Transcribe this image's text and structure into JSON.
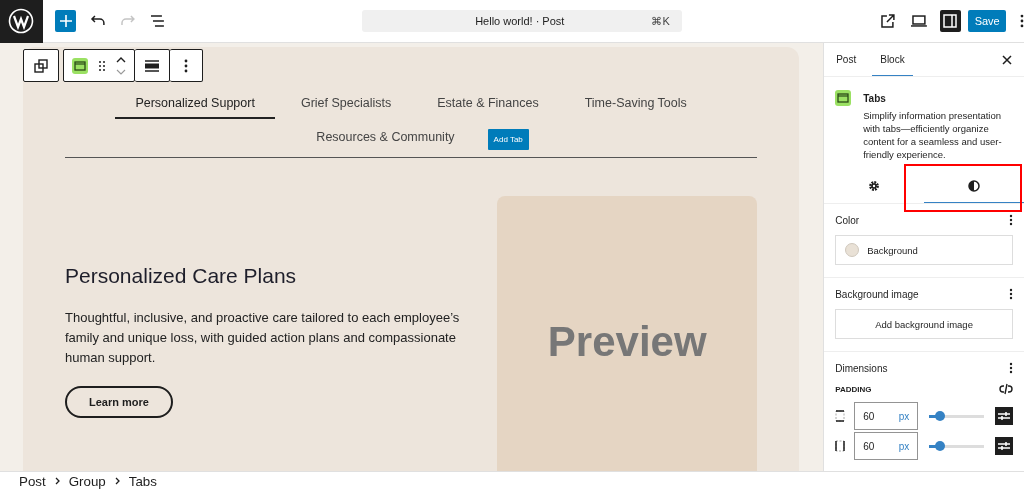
{
  "top_bar": {
    "command_title": "Hello world! · Post",
    "shortcut": "⌘K",
    "redo_disabled": true,
    "sidebar_on": true,
    "save": "Save"
  },
  "tabs_block": {
    "tabs": [
      {
        "label": "Personalized Support",
        "selected": true
      },
      {
        "label": "Grief Specialists",
        "selected": false
      },
      {
        "label": "Estate & Finances",
        "selected": false
      },
      {
        "label": "Time-Saving Tools",
        "selected": false
      },
      {
        "label": "Resources & Community",
        "selected": false
      }
    ],
    "add_tab": "Add Tab",
    "heading": "Personalized Care Plans",
    "body": "Thoughtful, inclusive, and proactive care tailored to each employee’s family and unique loss, with guided action plans and compassionate human support.",
    "button": "Learn more",
    "preview": "Preview"
  },
  "sidebar": {
    "tabs": [
      {
        "label": "Post",
        "selected": false
      },
      {
        "label": "Block",
        "selected": true
      }
    ],
    "block": {
      "title": "Tabs",
      "description": "Simplify information presentation with tabs—efficiently organize content for a seamless and user-friendly experience."
    },
    "style_tabs": [
      {
        "kind": "settings",
        "selected": false
      },
      {
        "kind": "styles",
        "selected": true
      }
    ],
    "color": {
      "title": "Color",
      "items": [
        {
          "label": "Background",
          "color": "#e9e1d6"
        }
      ]
    },
    "background_image": {
      "title": "Background image",
      "button": "Add background image"
    },
    "dimensions": {
      "title": "Dimensions",
      "padding_label": "PADDING",
      "rows": [
        {
          "kind": "vertical",
          "value": "60",
          "unit": "px",
          "level": 0.2
        },
        {
          "kind": "horizontal",
          "value": "60",
          "unit": "px",
          "level": 0.2
        }
      ]
    }
  },
  "breadcrumb": [
    "Post",
    "Group",
    "Tabs"
  ]
}
